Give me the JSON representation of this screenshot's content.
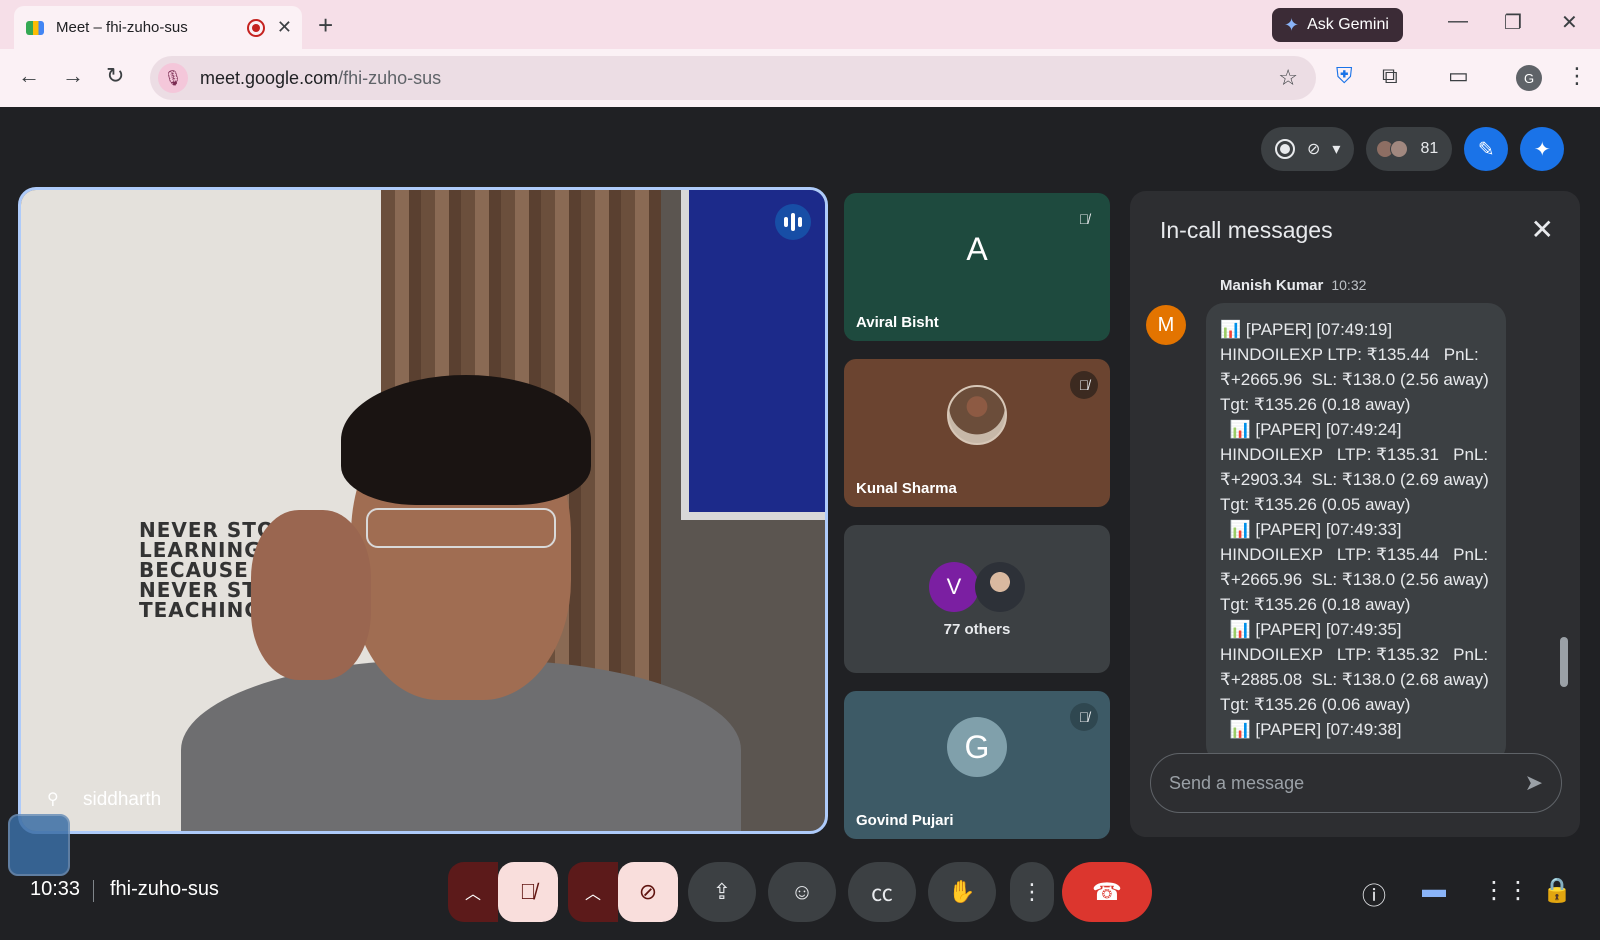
{
  "browser": {
    "tab_title": "Meet – fhi-zuho-sus",
    "new_tab": "+",
    "gemini_label": "Ask Gemini",
    "url_host": "meet.google.com",
    "url_path": "/fhi-zuho-sus",
    "profile_initial": "G"
  },
  "meet": {
    "participant_count": "81",
    "main_tile": {
      "name": "siddharth",
      "poster_text": "NEVER STOP\nLEARNING\nBECAUSE\nNEVER STOP\nTEACHING"
    },
    "side_tiles": [
      {
        "initial": "A",
        "name": "Aviral Bisht",
        "bg": "#1e4a3e"
      },
      {
        "name": "Kunal Sharma",
        "bg": "#6b4430"
      },
      {
        "initial": "V",
        "label": "77 others",
        "bg": "#3c4043"
      },
      {
        "initial": "G",
        "name": "Govind Pujari",
        "bg": "#3d5a66"
      }
    ],
    "chat": {
      "title": "In-call messages",
      "sender": "Manish Kumar",
      "sender_initial": "M",
      "time": "10:32",
      "message_lines": [
        "📊 [PAPER] [07:49:19] HINDOILEXP LTP: ₹135.44   PnL: ₹+2665.96  SL: ₹138.0 (2.56 away)  Tgt: ₹135.26 (0.18 away)",
        "  📊 [PAPER] [07:49:24] HINDOILEXP   LTP: ₹135.31   PnL: ₹+2903.34  SL: ₹138.0 (2.69 away)  Tgt: ₹135.26 (0.05 away)",
        "  📊 [PAPER] [07:49:33] HINDOILEXP   LTP: ₹135.44   PnL: ₹+2665.96  SL: ₹138.0 (2.56 away)  Tgt: ₹135.26 (0.18 away)",
        "  📊 [PAPER] [07:49:35] HINDOILEXP   LTP: ₹135.32   PnL: ₹+2885.08  SL: ₹138.0 (2.68 away)  Tgt: ₹135.26 (0.06 away)",
        "  📊 [PAPER] [07:49:38]"
      ],
      "placeholder": "Send a message"
    },
    "bottom": {
      "clock": "10:33",
      "meeting_code": "fhi-zuho-sus"
    }
  },
  "colors": {
    "leave": "#dc362e",
    "accent": "#1a73e8",
    "muted_bg": "#f9dedc"
  }
}
